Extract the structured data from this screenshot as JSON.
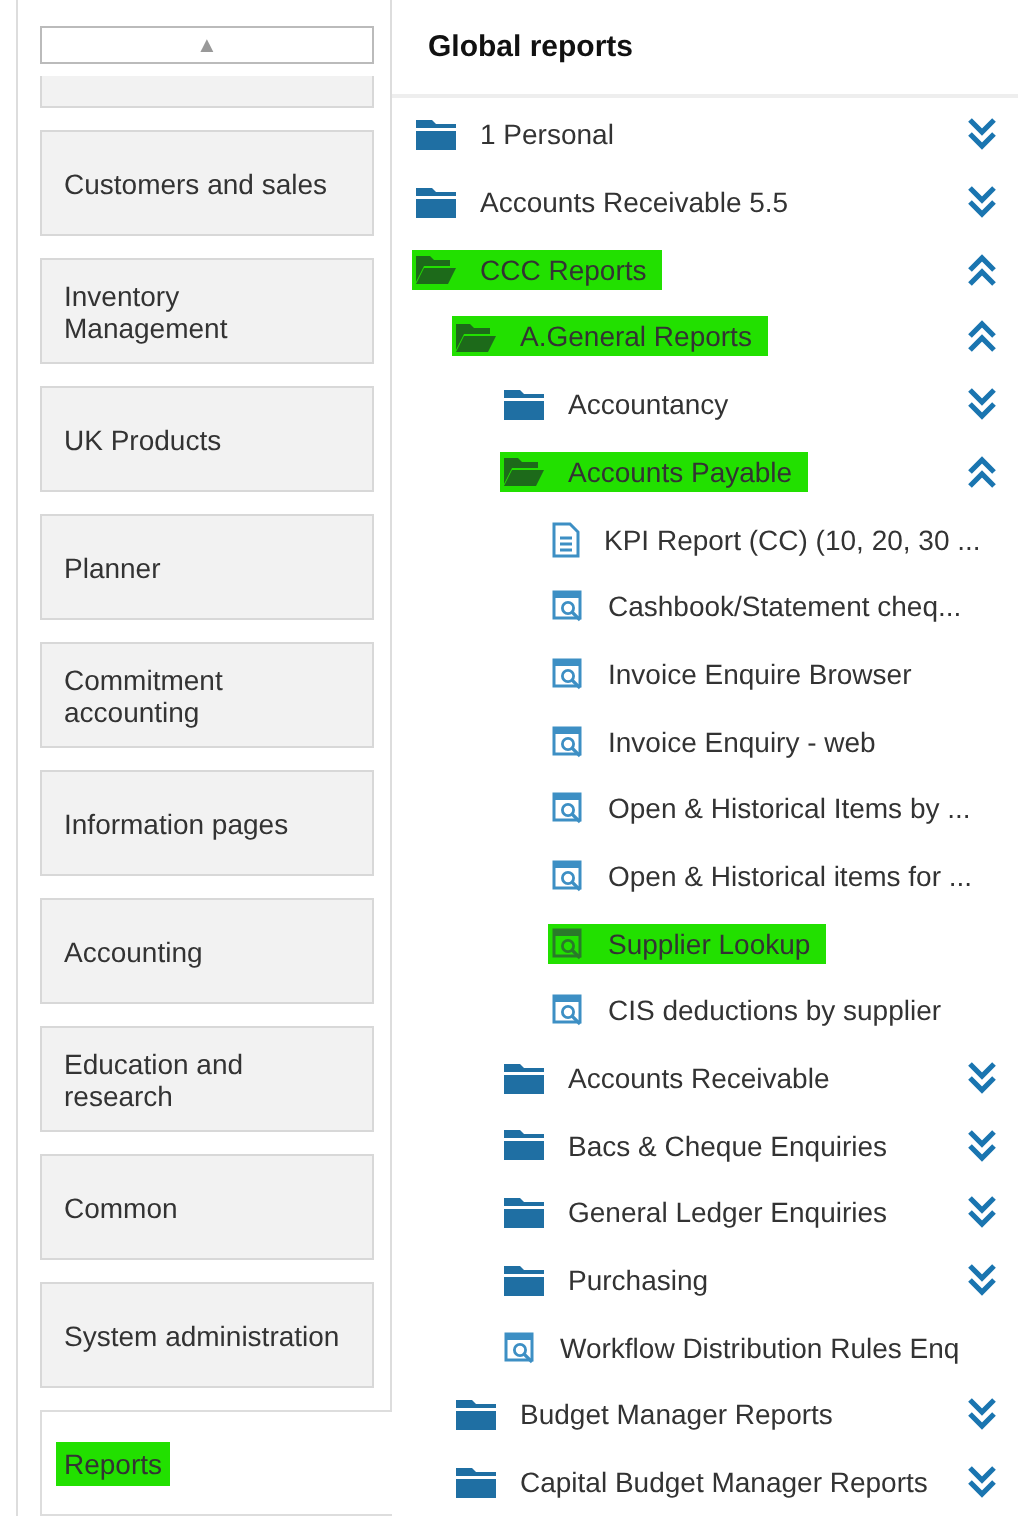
{
  "nav": {
    "scroll_up": "▲",
    "items": [
      {
        "label": "Customers and sales",
        "selected": false,
        "highlighted": false
      },
      {
        "label": "Inventory Management",
        "selected": false,
        "highlighted": false
      },
      {
        "label": "UK Products",
        "selected": false,
        "highlighted": false
      },
      {
        "label": "Planner",
        "selected": false,
        "highlighted": false
      },
      {
        "label": "Commitment accounting",
        "selected": false,
        "highlighted": false
      },
      {
        "label": "Information pages",
        "selected": false,
        "highlighted": false
      },
      {
        "label": "Accounting",
        "selected": false,
        "highlighted": false
      },
      {
        "label": "Education and research",
        "selected": false,
        "highlighted": false
      },
      {
        "label": "Common",
        "selected": false,
        "highlighted": false
      },
      {
        "label": "System administration",
        "selected": false,
        "highlighted": false
      },
      {
        "label": "Reports",
        "selected": true,
        "highlighted": true
      }
    ]
  },
  "panel": {
    "title": "Global reports",
    "tree": [
      {
        "kind": "folder",
        "label": "1 Personal",
        "expanded": false,
        "highlighted": false
      },
      {
        "kind": "folder",
        "label": "Accounts Receivable 5.5",
        "expanded": false,
        "highlighted": false
      },
      {
        "kind": "folder",
        "label": "CCC Reports",
        "expanded": true,
        "highlighted": true,
        "children": [
          {
            "kind": "folder",
            "label": "A.General Reports",
            "expanded": true,
            "highlighted": true,
            "children": [
              {
                "kind": "folder",
                "label": "Accountancy",
                "expanded": false,
                "highlighted": false
              },
              {
                "kind": "folder",
                "label": "Accounts Payable",
                "expanded": true,
                "highlighted": true,
                "children": [
                  {
                    "kind": "document",
                    "label": "KPI Report (CC) (10, 20, 30 ...",
                    "highlighted": false
                  },
                  {
                    "kind": "query",
                    "label": "Cashbook/Statement cheq...",
                    "highlighted": false
                  },
                  {
                    "kind": "query",
                    "label": "Invoice Enquire Browser",
                    "highlighted": false
                  },
                  {
                    "kind": "query",
                    "label": "Invoice Enquiry - web",
                    "highlighted": false
                  },
                  {
                    "kind": "query",
                    "label": "Open & Historical Items by ...",
                    "highlighted": false
                  },
                  {
                    "kind": "query",
                    "label": "Open & Historical items for ...",
                    "highlighted": false
                  },
                  {
                    "kind": "query",
                    "label": "Supplier Lookup",
                    "highlighted": true
                  },
                  {
                    "kind": "query",
                    "label": "CIS deductions by supplier",
                    "highlighted": false
                  }
                ]
              },
              {
                "kind": "folder",
                "label": "Accounts Receivable",
                "expanded": false,
                "highlighted": false
              },
              {
                "kind": "folder",
                "label": "Bacs & Cheque Enquiries",
                "expanded": false,
                "highlighted": false
              },
              {
                "kind": "folder",
                "label": "General Ledger Enquiries",
                "expanded": false,
                "highlighted": false
              },
              {
                "kind": "folder",
                "label": "Purchasing",
                "expanded": false,
                "highlighted": false
              },
              {
                "kind": "query",
                "label": "Workflow Distribution Rules Enq",
                "highlighted": false
              }
            ]
          },
          {
            "kind": "folder",
            "label": "Budget Manager Reports",
            "expanded": false,
            "highlighted": false
          },
          {
            "kind": "folder",
            "label": "Capital Budget Manager Reports",
            "expanded": false,
            "highlighted": false
          }
        ]
      }
    ]
  }
}
